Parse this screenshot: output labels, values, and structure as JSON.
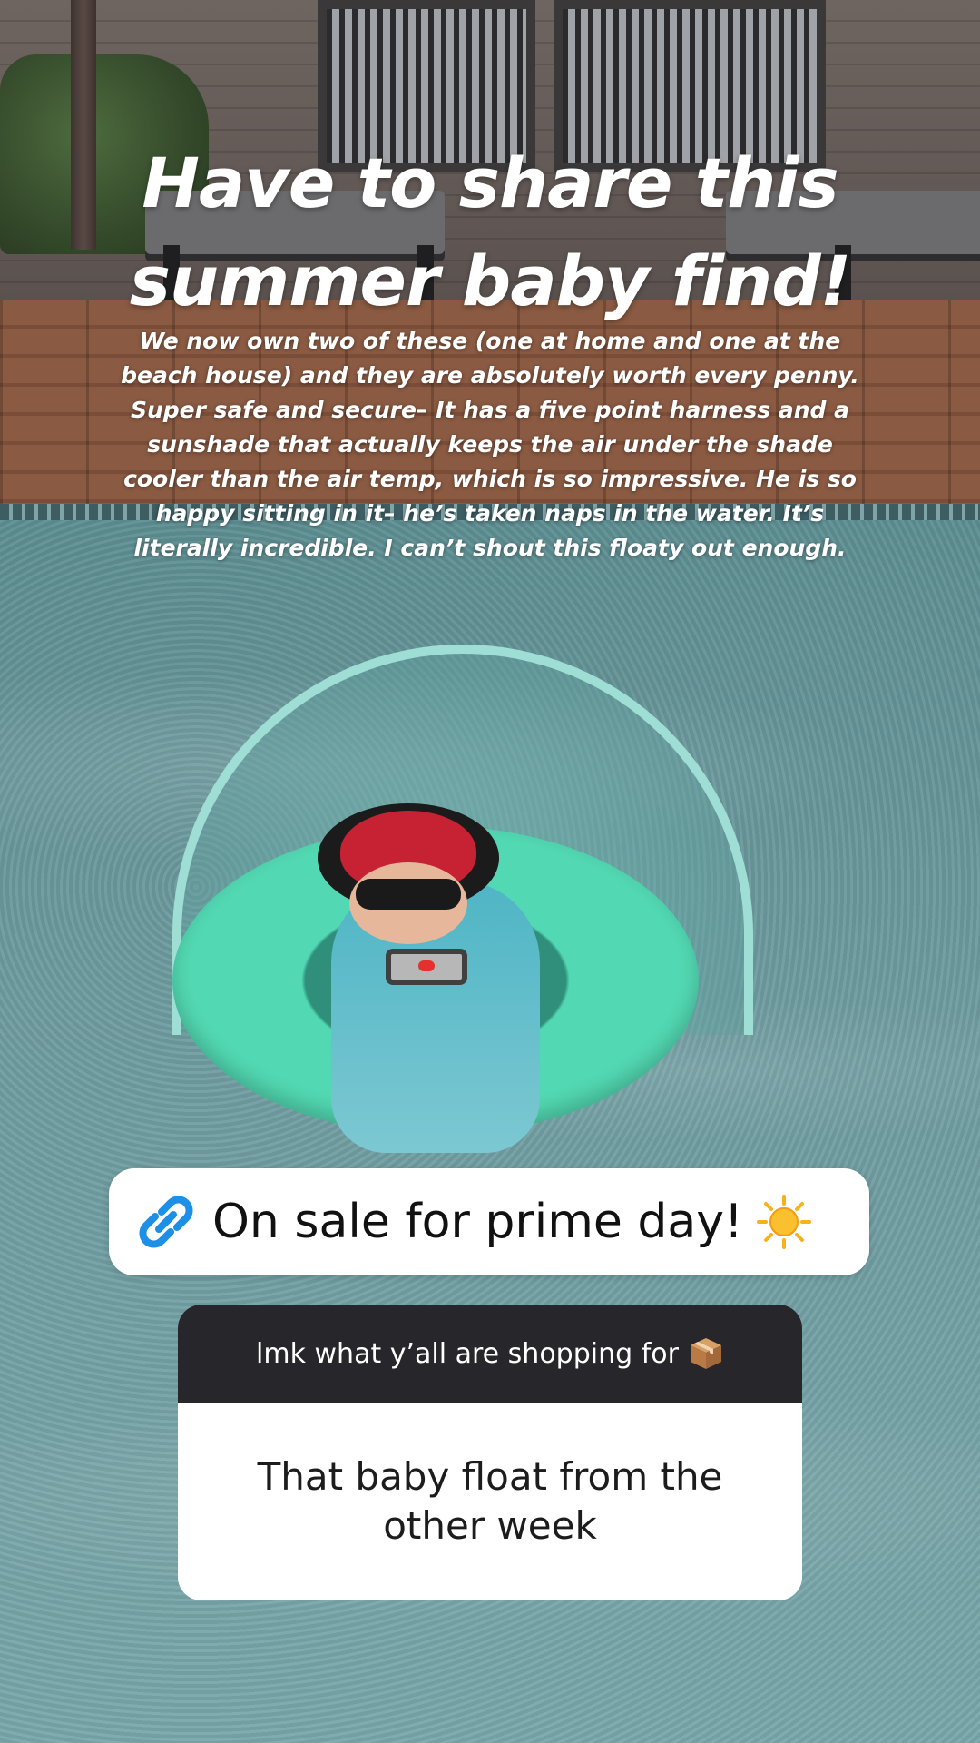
{
  "story": {
    "headline": "Have to share this summer baby find!",
    "body": "We now own two of these (one at home and one at the beach house) and they are absolutely worth every penny. Super safe and secure– It has a five point harness and a sunshade that actually keeps the air under the shade cooler than the air temp, which is so impressive. He is so happy sitting in it– he’s taken naps in the water. It’s literally incredible. I can’t shout this floaty out enough."
  },
  "link_sticker": {
    "label": "On sale for prime day!",
    "icon": "link-icon",
    "emoji_icon": "sun-icon",
    "icon_color": "#1d8fe6"
  },
  "question_card": {
    "prompt": "lmk what y’all are shopping for",
    "prompt_icon": "package-icon",
    "answer": "That baby float from the other week",
    "header_color": "#26262b"
  }
}
